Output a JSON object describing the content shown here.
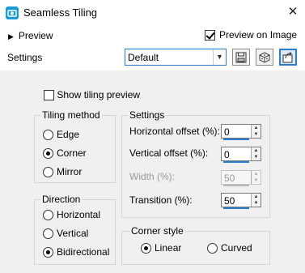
{
  "window": {
    "title": "Seamless Tiling",
    "close_glyph": "✕"
  },
  "top": {
    "preview_label": "Preview",
    "preview_on_image_label": "Preview on Image",
    "preview_on_image_checked": true,
    "settings_label": "Settings",
    "preset_value": "Default"
  },
  "panel": {
    "show_tiling_preview_label": "Show tiling preview",
    "show_tiling_preview_checked": false,
    "tiling_method": {
      "title": "Tiling method",
      "options": [
        "Edge",
        "Corner",
        "Mirror"
      ],
      "selected": "Corner"
    },
    "settings": {
      "title": "Settings",
      "horizontal_offset_label": "Horizontal offset (%):",
      "horizontal_offset_value": "0",
      "vertical_offset_label": "Vertical offset (%):",
      "vertical_offset_value": "0",
      "width_label": "Width (%):",
      "width_value": "50",
      "transition_label": "Transition (%):",
      "transition_value": "50"
    },
    "direction": {
      "title": "Direction",
      "options": [
        "Horizontal",
        "Vertical",
        "Bidirectional"
      ],
      "selected": "Bidirectional"
    },
    "corner_style": {
      "title": "Corner style",
      "options": [
        "Linear",
        "Curved"
      ],
      "selected": "Linear"
    }
  },
  "colors": {
    "accent": "#2b7dd1",
    "app_icon": "#1a9bd7"
  }
}
